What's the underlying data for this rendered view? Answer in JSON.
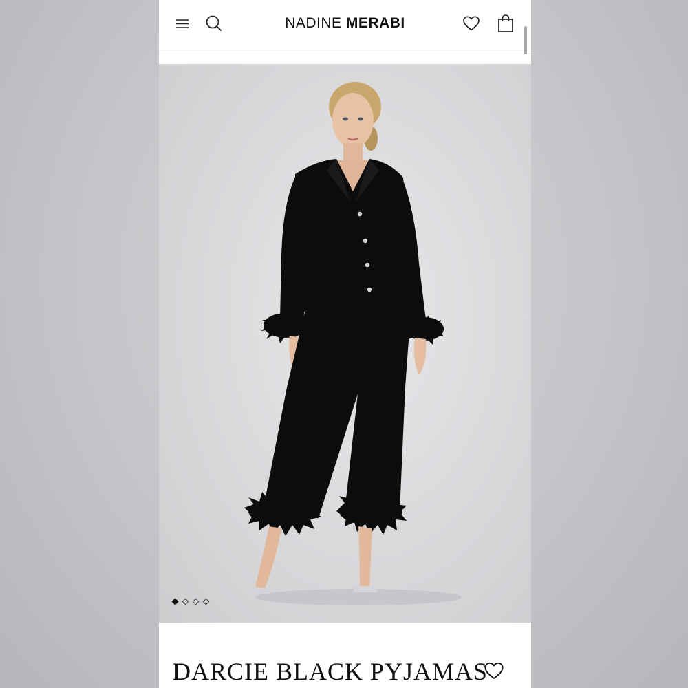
{
  "header": {
    "brand_light": "NADINE",
    "brand_bold": "MERABI",
    "icons": [
      "menu-icon",
      "search-icon",
      "heart-icon",
      "shopping-bag-icon"
    ]
  },
  "carousel": {
    "image_alt": "Model wearing Darcie Black Pyjamas with feather trim",
    "total_slides": 4,
    "active_slide": 1
  },
  "product": {
    "title": "DARCIE BLACK PYJAMAS"
  },
  "colors": {
    "page_bg": "#c4c2c6",
    "panel_bg": "#ffffff",
    "text": "#111111",
    "garment": "#0c0c0d"
  }
}
